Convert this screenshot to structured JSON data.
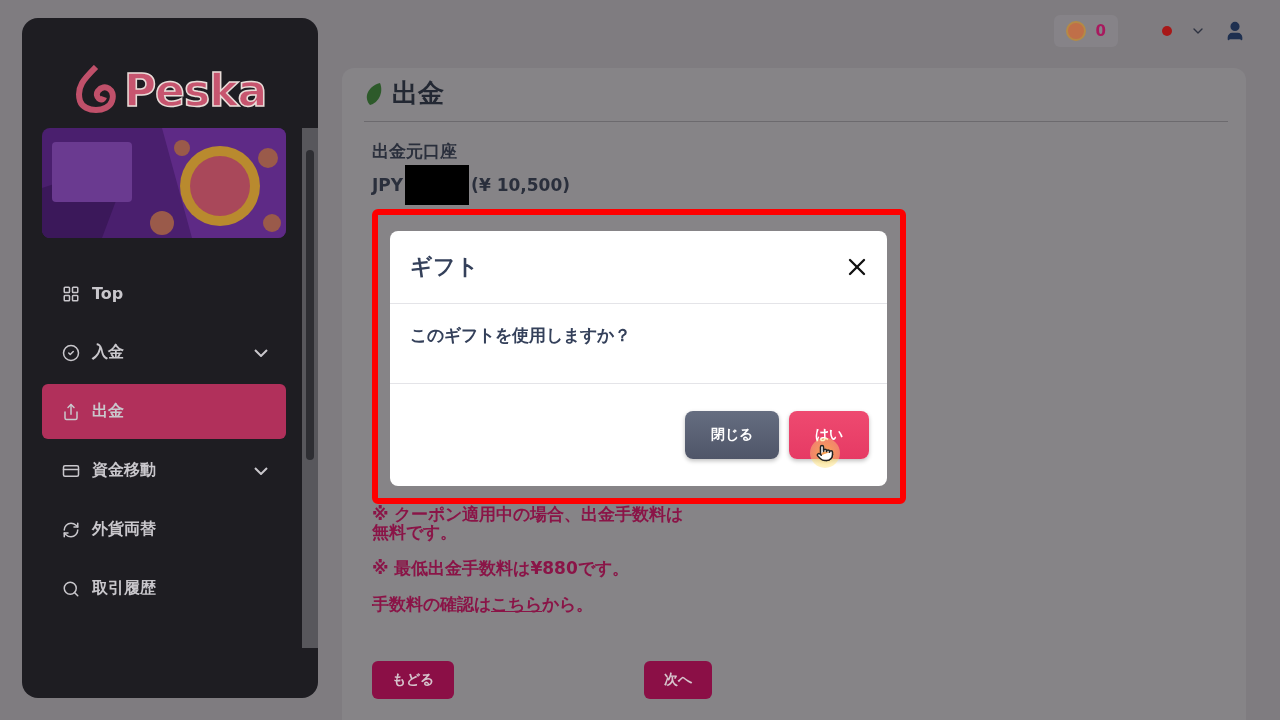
{
  "sidebar": {
    "logo": "Peska",
    "items": [
      {
        "label": "Top",
        "expandable": false,
        "selected": false
      },
      {
        "label": "入金",
        "expandable": true,
        "selected": false
      },
      {
        "label": "出金",
        "expandable": false,
        "selected": true
      },
      {
        "label": "資金移動",
        "expandable": true,
        "selected": false
      },
      {
        "label": "外貨両替",
        "expandable": false,
        "selected": false
      },
      {
        "label": "取引履歴",
        "expandable": false,
        "selected": false
      }
    ]
  },
  "topbar": {
    "points": "0"
  },
  "page": {
    "title": "出金",
    "source_label": "出金元口座",
    "source_currency": "JPY",
    "source_balance": "(¥ 10,500)",
    "notes": [
      "※ クーポン適用中の場合、出金手数料は無料です。",
      "※ 最低出金手数料は¥880です。"
    ],
    "fee_line": {
      "prefix": "手数料の確認は",
      "link": "こちら",
      "suffix": "から。"
    },
    "back_button": "もどる",
    "next_button": "次へ"
  },
  "dialog": {
    "title": "ギフト",
    "message": "このギフトを使用しますか？",
    "buttons": [
      {
        "label": "閉じる",
        "kind": "secondary"
      },
      {
        "label": "はい",
        "kind": "primary"
      }
    ]
  }
}
